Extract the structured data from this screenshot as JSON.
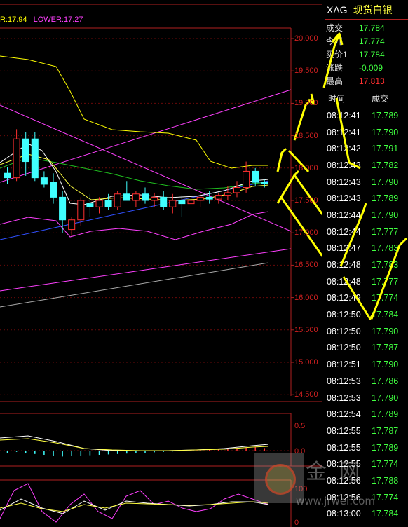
{
  "header": {
    "boll_upper_label": "R:17.94",
    "boll_lower_label": "LOWER:17.27"
  },
  "symbol": {
    "code": "XAG",
    "name": "现货白银"
  },
  "quote": [
    {
      "label": "成交",
      "value": "17.784",
      "color": "green"
    },
    {
      "label": "今开",
      "value": "17.774",
      "color": "green"
    },
    {
      "label": "买价1",
      "value": "17.784",
      "color": "green"
    },
    {
      "label": "涨跌",
      "value": "-0.009",
      "color": "green"
    },
    {
      "label": "最高",
      "value": "17.813",
      "color": "red"
    }
  ],
  "ticks_header": {
    "time": "时间",
    "price": "成交"
  },
  "ticks": [
    {
      "time": "08:12:41",
      "price": "17.789"
    },
    {
      "time": "08:12:41",
      "price": "17.790"
    },
    {
      "time": "08:12:42",
      "price": "17.791"
    },
    {
      "time": "08:12:43",
      "price": "17.782"
    },
    {
      "time": "08:12:43",
      "price": "17.790"
    },
    {
      "time": "08:12:43",
      "price": "17.789"
    },
    {
      "time": "08:12:44",
      "price": "17.790"
    },
    {
      "time": "08:12:44",
      "price": "17.777"
    },
    {
      "time": "08:12:47",
      "price": "17.783"
    },
    {
      "time": "08:12:48",
      "price": "17.783"
    },
    {
      "time": "08:12:48",
      "price": "17.777"
    },
    {
      "time": "08:12:49",
      "price": "17.774"
    },
    {
      "time": "08:12:50",
      "price": "17.784"
    },
    {
      "time": "08:12:50",
      "price": "17.790"
    },
    {
      "time": "08:12:50",
      "price": "17.787"
    },
    {
      "time": "08:12:51",
      "price": "17.790"
    },
    {
      "time": "08:12:53",
      "price": "17.786"
    },
    {
      "time": "08:12:53",
      "price": "17.790"
    },
    {
      "time": "08:12:54",
      "price": "17.789"
    },
    {
      "time": "08:12:55",
      "price": "17.787"
    },
    {
      "time": "08:12:55",
      "price": "17.789"
    },
    {
      "time": "08:12:55",
      "price": "17.774"
    },
    {
      "time": "08:12:56",
      "price": "17.788"
    },
    {
      "time": "08:12:56",
      "price": "17.774"
    },
    {
      "time": "08:13:00",
      "price": "17.784"
    }
  ],
  "chart_data": {
    "type": "candlestick",
    "y_ticks": [
      "20.000",
      "19.500",
      "19.000",
      "18.500",
      "18.000",
      "17.500",
      "17.000",
      "16.500",
      "16.000",
      "15.500",
      "15.000",
      "14.500"
    ],
    "ylim": [
      14.5,
      20.0
    ],
    "indicator_ticks": [
      "0.5",
      "0.0"
    ],
    "lower_ticks": [
      "100",
      "0"
    ],
    "candles": [
      {
        "o": 17.92,
        "h": 18.02,
        "l": 17.75,
        "c": 17.85
      },
      {
        "o": 17.85,
        "h": 18.6,
        "l": 17.8,
        "c": 18.45
      },
      {
        "o": 18.45,
        "h": 18.55,
        "l": 17.88,
        "c": 18.1
      },
      {
        "o": 18.45,
        "h": 18.55,
        "l": 17.8,
        "c": 17.85
      },
      {
        "o": 17.85,
        "h": 17.95,
        "l": 17.7,
        "c": 17.75
      },
      {
        "o": 17.78,
        "h": 17.92,
        "l": 17.45,
        "c": 17.55
      },
      {
        "o": 17.55,
        "h": 17.65,
        "l": 17.0,
        "c": 17.2
      },
      {
        "o": 17.05,
        "h": 17.25,
        "l": 16.95,
        "c": 17.2
      },
      {
        "o": 17.2,
        "h": 17.55,
        "l": 17.1,
        "c": 17.5
      },
      {
        "o": 17.45,
        "h": 17.6,
        "l": 17.25,
        "c": 17.4
      },
      {
        "o": 17.4,
        "h": 17.55,
        "l": 17.3,
        "c": 17.5
      },
      {
        "o": 17.5,
        "h": 17.6,
        "l": 17.35,
        "c": 17.4
      },
      {
        "o": 17.4,
        "h": 17.65,
        "l": 17.35,
        "c": 17.6
      },
      {
        "o": 17.6,
        "h": 17.8,
        "l": 17.5,
        "c": 17.5
      },
      {
        "o": 17.5,
        "h": 17.65,
        "l": 17.4,
        "c": 17.6
      },
      {
        "o": 17.6,
        "h": 17.7,
        "l": 17.45,
        "c": 17.5
      },
      {
        "o": 17.5,
        "h": 17.62,
        "l": 17.4,
        "c": 17.55
      },
      {
        "o": 17.55,
        "h": 17.65,
        "l": 17.35,
        "c": 17.4
      },
      {
        "o": 17.4,
        "h": 17.6,
        "l": 17.3,
        "c": 17.5
      },
      {
        "o": 17.5,
        "h": 17.58,
        "l": 17.25,
        "c": 17.45
      },
      {
        "o": 17.45,
        "h": 17.55,
        "l": 17.35,
        "c": 17.5
      },
      {
        "o": 17.5,
        "h": 17.62,
        "l": 17.4,
        "c": 17.55
      },
      {
        "o": 17.55,
        "h": 17.65,
        "l": 17.45,
        "c": 17.52
      },
      {
        "o": 17.52,
        "h": 17.62,
        "l": 17.45,
        "c": 17.58
      },
      {
        "o": 17.58,
        "h": 17.72,
        "l": 17.5,
        "c": 17.62
      },
      {
        "o": 17.62,
        "h": 17.8,
        "l": 17.55,
        "c": 17.7
      },
      {
        "o": 17.7,
        "h": 18.1,
        "l": 17.62,
        "c": 17.95
      },
      {
        "o": 17.95,
        "h": 18.0,
        "l": 17.72,
        "c": 17.78
      },
      {
        "o": 17.78,
        "h": 17.82,
        "l": 17.7,
        "c": 17.77
      }
    ],
    "macd": [
      -0.05,
      -0.03,
      -0.06,
      -0.08,
      -0.1,
      -0.12,
      -0.14,
      -0.13,
      -0.12,
      -0.11,
      -0.1,
      -0.09,
      -0.08,
      -0.07,
      -0.06,
      -0.05,
      -0.04,
      -0.03,
      -0.02,
      -0.01,
      0.01,
      0.02,
      0.03,
      0.04,
      0.05,
      0.06,
      0.07,
      0.08,
      0.06
    ]
  },
  "watermark": {
    "logo_text": "金 网",
    "url": "www.jrwei.com"
  }
}
